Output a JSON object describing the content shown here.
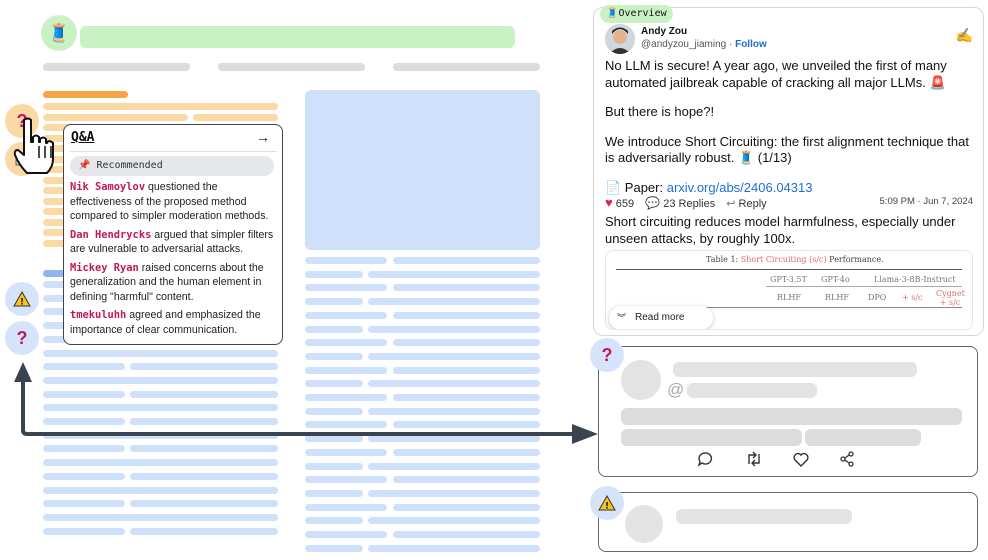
{
  "overview_tab": "Overview",
  "qa": {
    "title": "Q&A",
    "arrow": "→",
    "recommended": "Recommended",
    "entries": [
      {
        "name": "Nik Samoylov",
        "text": " questioned the effectiveness of the proposed method compared to simpler moderation methods."
      },
      {
        "name": "Dan Hendrycks",
        "text": " argued that simpler filters are vulnerable to adversarial attacks."
      },
      {
        "name": "Mickey Ryan",
        "text": " raised concerns about the generalization and the human element in defining \"harmful\" content."
      },
      {
        "name": "tmekuluhh",
        "text": " agreed and emphasized the importance of clear communication."
      }
    ]
  },
  "tweet": {
    "name": "Andy Zou",
    "handle": "@andyzou_jiaming · ",
    "follow": "Follow",
    "p1": "No LLM is secure! A year ago, we unveiled the first of many automated jailbreak capable of cracking all major LLMs. 🚨",
    "p2": "But there is hope?!",
    "p3": "We introduce Short Circuiting: the first alignment technique that is adversarially robust. 🧵 (1/13)",
    "paper_label": "📄 Paper: ",
    "paper_link": "arxiv.org/abs/2406.04313",
    "likes": "659",
    "replies": "23 Replies",
    "reply": "Reply",
    "timestamp": "5:09 PM · Jun 7, 2024",
    "desc": "Short circuiting reduces model harmfulness, especially under unseen attacks, by roughly 100x.",
    "table_caption_prefix": "Table 1: ",
    "table_caption_red": "Short Circuiting (s/c)",
    "table_caption_suffix": " Performance.",
    "col_gpt35": "GPT-3.5T",
    "col_gpt4o": "GPT-4o",
    "col_llama": "Llama-3-8B-Instruct",
    "sub_rlhf1": "RLHF",
    "sub_rlhf2": "RLHF",
    "sub_dpo": "DPO",
    "sub_sc": "+ s/c",
    "sub_cygnet": "Cygnet + s/c",
    "read_more": "Read more"
  },
  "colors": {
    "accent_red": "#c2185b",
    "link_blue": "#1d6fd8",
    "arrow": "#3a4450"
  }
}
